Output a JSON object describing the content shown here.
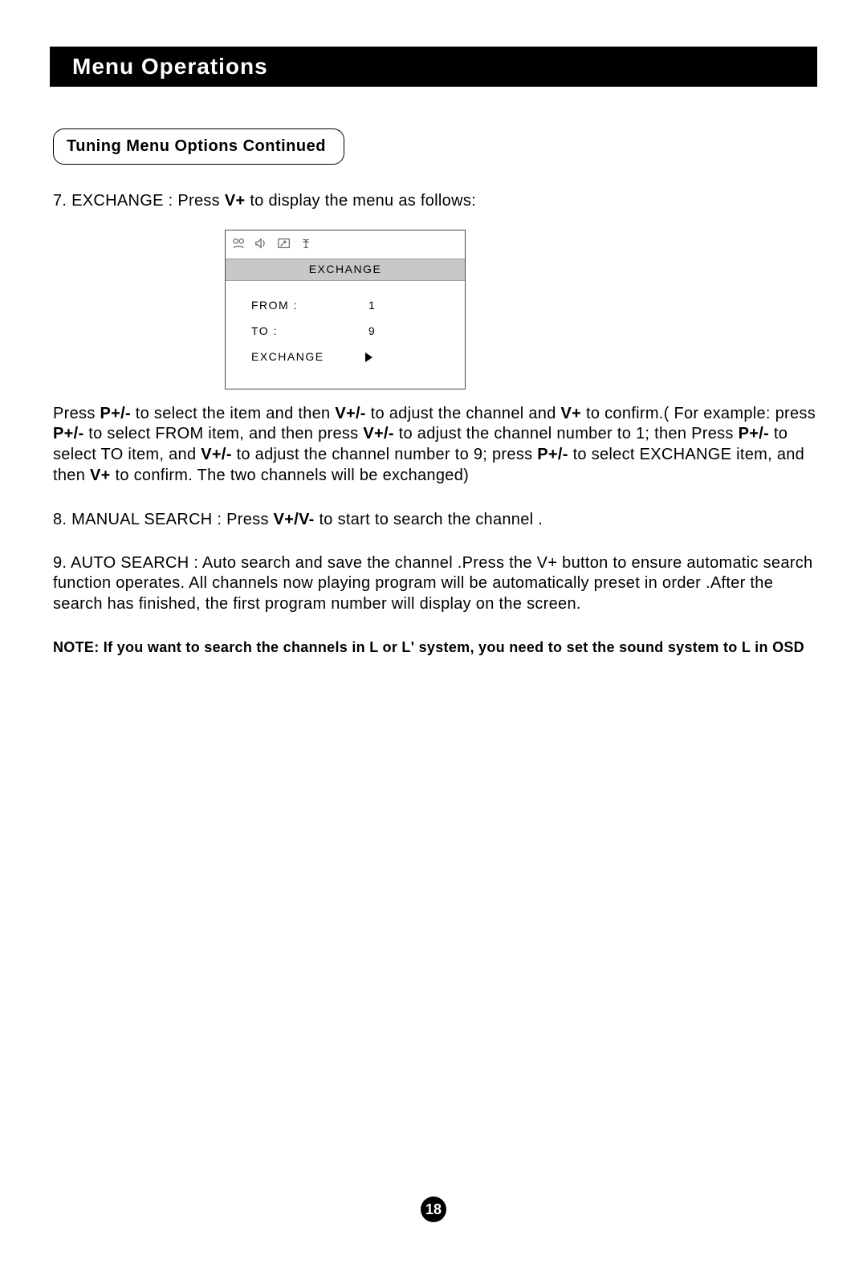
{
  "header": "Menu Operations",
  "section_label": "Tuning Menu Options Continued",
  "item7_pre": "7. EXCHANGE : Press ",
  "item7_key": "V+",
  "item7_post": " to display the menu as follows:",
  "menu": {
    "title": "EXCHANGE",
    "rows": [
      {
        "label": "FROM :",
        "value": "1"
      },
      {
        "label": "TO :",
        "value": "9"
      },
      {
        "label": "EXCHANGE",
        "value": "arrow"
      }
    ]
  },
  "para2_parts": {
    "t1": "Press ",
    "b1": "P+/-",
    "t2": " to select the item and then ",
    "b2": "V+/-",
    "t3": " to adjust the channel and ",
    "b3": "V+",
    "t4": " to confirm.( For example: press ",
    "b4": "P+/-",
    "t5": " to select FROM item, and then press ",
    "b5": "V+/-",
    "t6": " to adjust the channel number to 1; then Press ",
    "b6": "P+/-",
    "t7": " to select TO item, and ",
    "b7": "V+/-",
    "t8": " to adjust the channel number to 9; press ",
    "b8": "P+/-",
    "t9": " to select EXCHANGE item, and then ",
    "b9": "V+",
    "t10": " to confirm. The two channels will be exchanged)"
  },
  "item8_pre": "8. MANUAL SEARCH : Press ",
  "item8_key": "V+/V-",
  "item8_post": " to start to search the channel .",
  "item9": "9. AUTO SEARCH : Auto search and save the channel .Press the V+ button to ensure automatic search function operates. All channels now playing program will be automatically preset in order .After the search has finished, the first program number will display on the screen.",
  "note": "NOTE: If you want to search the channels in L or L' system, you need to set the sound system to L in OSD",
  "page_number": "18"
}
